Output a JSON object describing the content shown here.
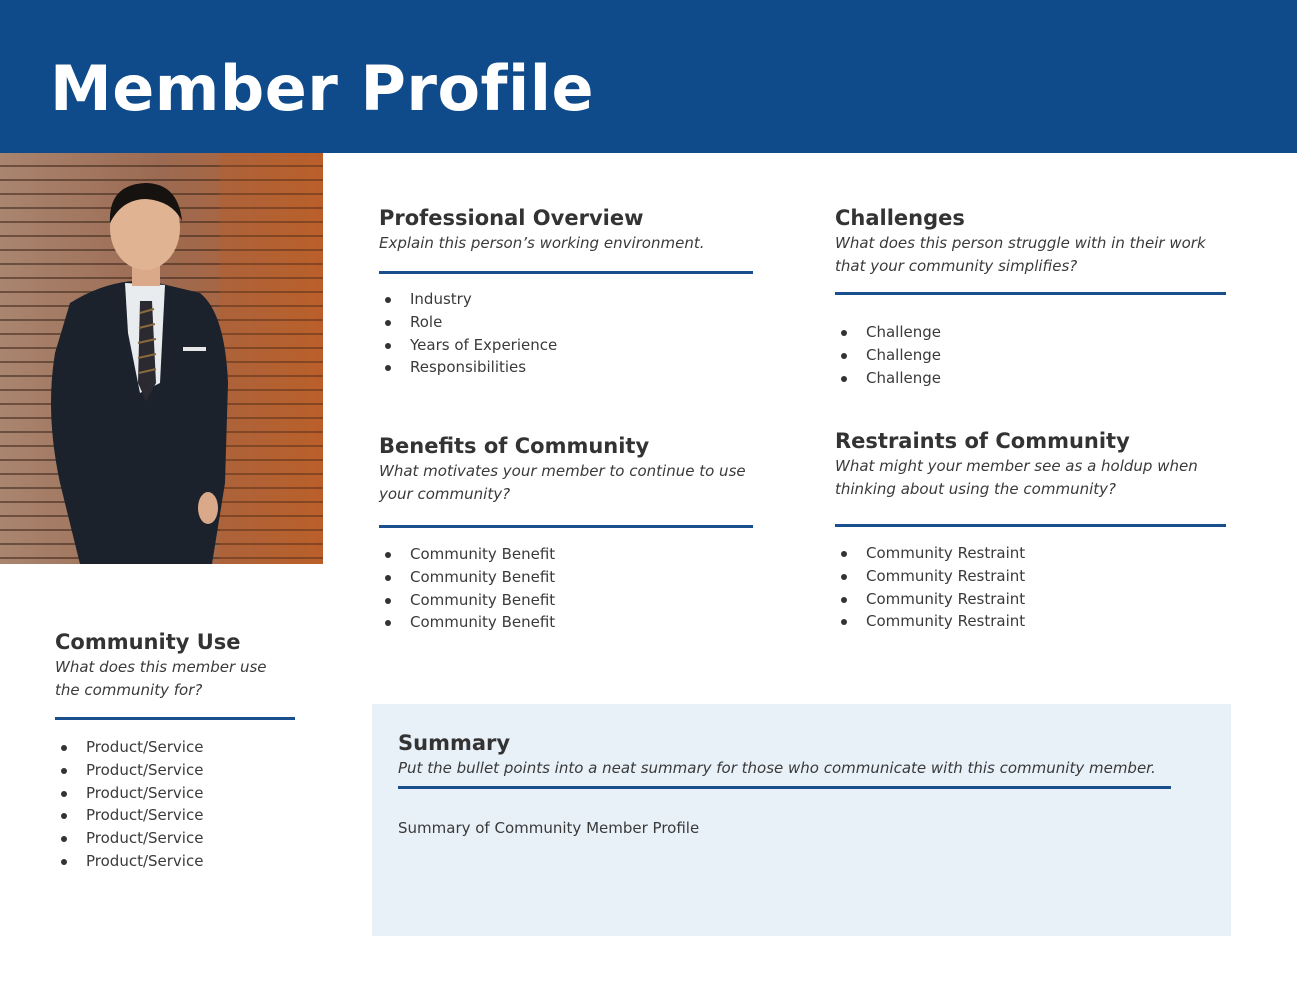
{
  "header": {
    "title": "Member Profile"
  },
  "colors": {
    "brand_blue": "#0f4a8a",
    "rule_blue": "#1a4f8e",
    "summary_bg": "#e8f0f8",
    "text": "#3a3a3a"
  },
  "photo": {
    "alt": "Smiling man in a dark suit and striped tie leaning against a horizontal wood-slat wall"
  },
  "sections": {
    "overview": {
      "title": "Professional Overview",
      "description": "Explain this person’s working environment.",
      "items": [
        "Industry",
        "Role",
        "Years of Experience",
        "Responsibilities"
      ]
    },
    "challenges": {
      "title": "Challenges",
      "description": "What does this person struggle with in their work that your community simplifies?",
      "items": [
        "Challenge",
        "Challenge",
        "Challenge"
      ]
    },
    "benefits": {
      "title": "Benefits of Community",
      "description": "What motivates your member to continue to use your community?",
      "items": [
        "Community Benefit",
        "Community Benefit",
        "Community Benefit",
        "Community Benefit"
      ]
    },
    "restraints": {
      "title": "Restraints of Community",
      "description": "What might your member see as a holdup when thinking about using the community?",
      "items": [
        "Community Restraint",
        "Community Restraint",
        "Community Restraint",
        "Community Restraint"
      ]
    },
    "use": {
      "title": "Community Use",
      "description": "What does this member use the community for?",
      "items": [
        "Product/Service",
        "Product/Service",
        "Product/Service",
        "Product/Service",
        "Product/Service",
        "Product/Service"
      ]
    },
    "summary": {
      "title": "Summary",
      "description": "Put the bullet points into a neat summary for those who communicate with this community member.",
      "body": "Summary of Community Member Profile"
    }
  }
}
